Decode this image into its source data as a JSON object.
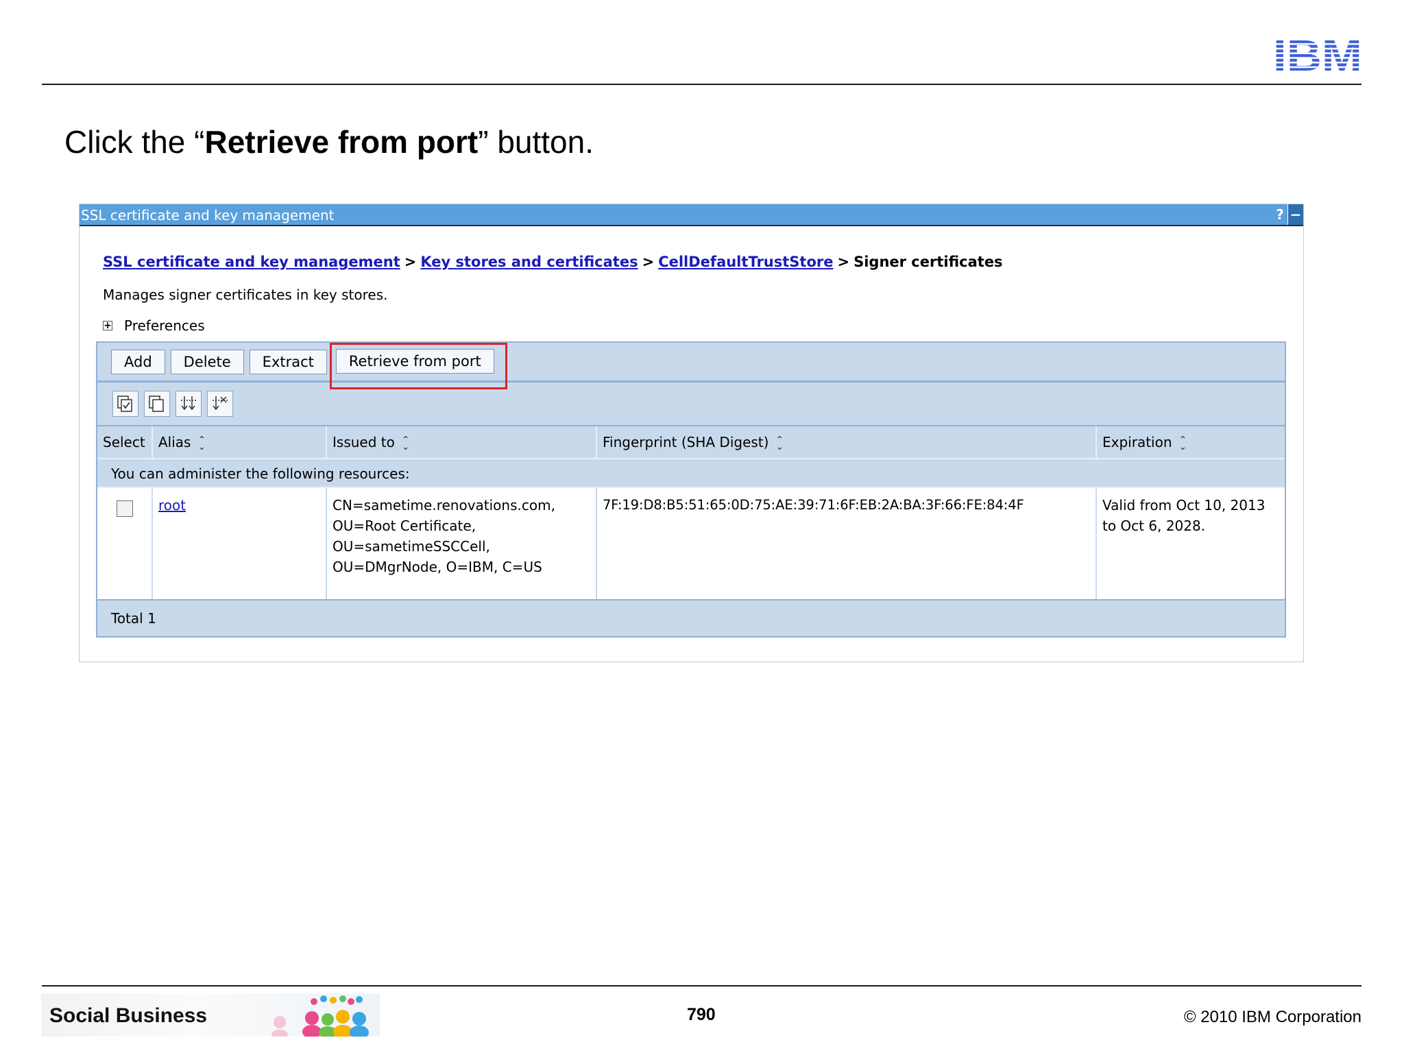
{
  "slide": {
    "instruction_prefix": "Click the “",
    "instruction_bold": "Retrieve from port",
    "instruction_suffix": "” button.",
    "logo_text": "IBM",
    "footer_brand": "Social Business",
    "page_number": "790",
    "copyright": "© 2010 IBM Corporation"
  },
  "panel": {
    "title": "SSL certificate and key management",
    "help_icon": "?",
    "minimize_icon": "−",
    "breadcrumbs": [
      {
        "label": "SSL certificate and key management"
      },
      {
        "label": "Key stores and certificates"
      },
      {
        "label": "CellDefaultTrustStore"
      }
    ],
    "breadcrumb_sep": ">",
    "breadcrumb_current": "Signer certificates",
    "description": "Manages signer certificates in key stores.",
    "preferences_label": "Preferences",
    "preferences_icon": "plus-box-icon"
  },
  "toolbar": {
    "buttons": [
      "Add",
      "Delete",
      "Extract",
      "Retrieve from port"
    ],
    "icon_buttons": [
      "select-all-icon",
      "deselect-all-icon",
      "show-filter-icon",
      "clear-filter-icon"
    ]
  },
  "table": {
    "headers": [
      "Select",
      "Alias",
      "Issued to",
      "Fingerprint (SHA Digest)",
      "Expiration"
    ],
    "note": "You can administer the following resources:",
    "rows": [
      {
        "alias": "root",
        "issued_to": [
          "CN=sametime.renovations.com,",
          "OU=Root Certificate,",
          "OU=sametimeSSCCell,",
          "OU=DMgrNode, O=IBM, C=US"
        ],
        "fingerprint": "7F:19:D8:B5:51:65:0D:75:AE:39:71:6F:EB:2A:BA:3F:66:FE:84:4F",
        "expiration": [
          "Valid from Oct 10, 2013",
          "to Oct 6, 2028."
        ]
      }
    ],
    "total": "Total 1"
  },
  "colors": {
    "titlebar": "#5aa0dd",
    "toolbar_bg": "#c9d9ec",
    "link": "#1a1ab8",
    "highlight": "#e0202a",
    "ibm_blue": "#3f5fd6"
  }
}
